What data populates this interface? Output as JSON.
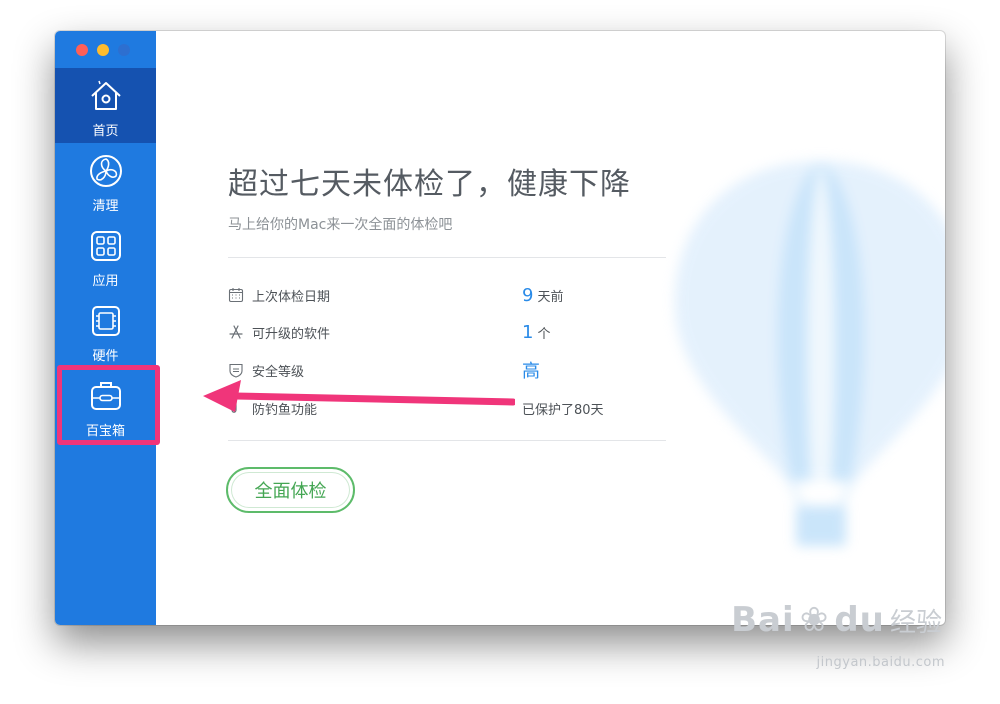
{
  "sidebar": {
    "items": [
      {
        "label": "首页",
        "icon": "home-icon",
        "active": true
      },
      {
        "label": "清理",
        "icon": "fan-icon",
        "active": false
      },
      {
        "label": "应用",
        "icon": "apps-grid-icon",
        "active": false
      },
      {
        "label": "硬件",
        "icon": "chip-icon",
        "active": false
      },
      {
        "label": "百宝箱",
        "icon": "toolbox-icon",
        "active": false
      }
    ]
  },
  "main": {
    "headline": "超过七天未体检了，健康下降",
    "subline": "马上给你的Mac来一次全面的体检吧",
    "stats": [
      {
        "label": "上次体检日期",
        "icon": "calendar-icon",
        "number": "9",
        "unit": "天前"
      },
      {
        "label": "可升级的软件",
        "icon": "app-store-icon",
        "number": "1",
        "unit": "个"
      },
      {
        "label": "安全等级",
        "icon": "shield-icon",
        "value": "高"
      },
      {
        "label": "防钓鱼功能",
        "icon": "hook-icon",
        "value": "已保护了80天"
      }
    ],
    "check_button": "全面体检"
  },
  "watermark": {
    "main": "Bai",
    "main2": "du",
    "cn": "经验",
    "url": "jingyan.baidu.com"
  },
  "colors": {
    "sidebar": "#1f7ae0",
    "sidebar_active": "#1552b0",
    "accent_blue": "#2a8be8",
    "button_green": "#44a653",
    "annotation_pink": "#f0357a"
  }
}
